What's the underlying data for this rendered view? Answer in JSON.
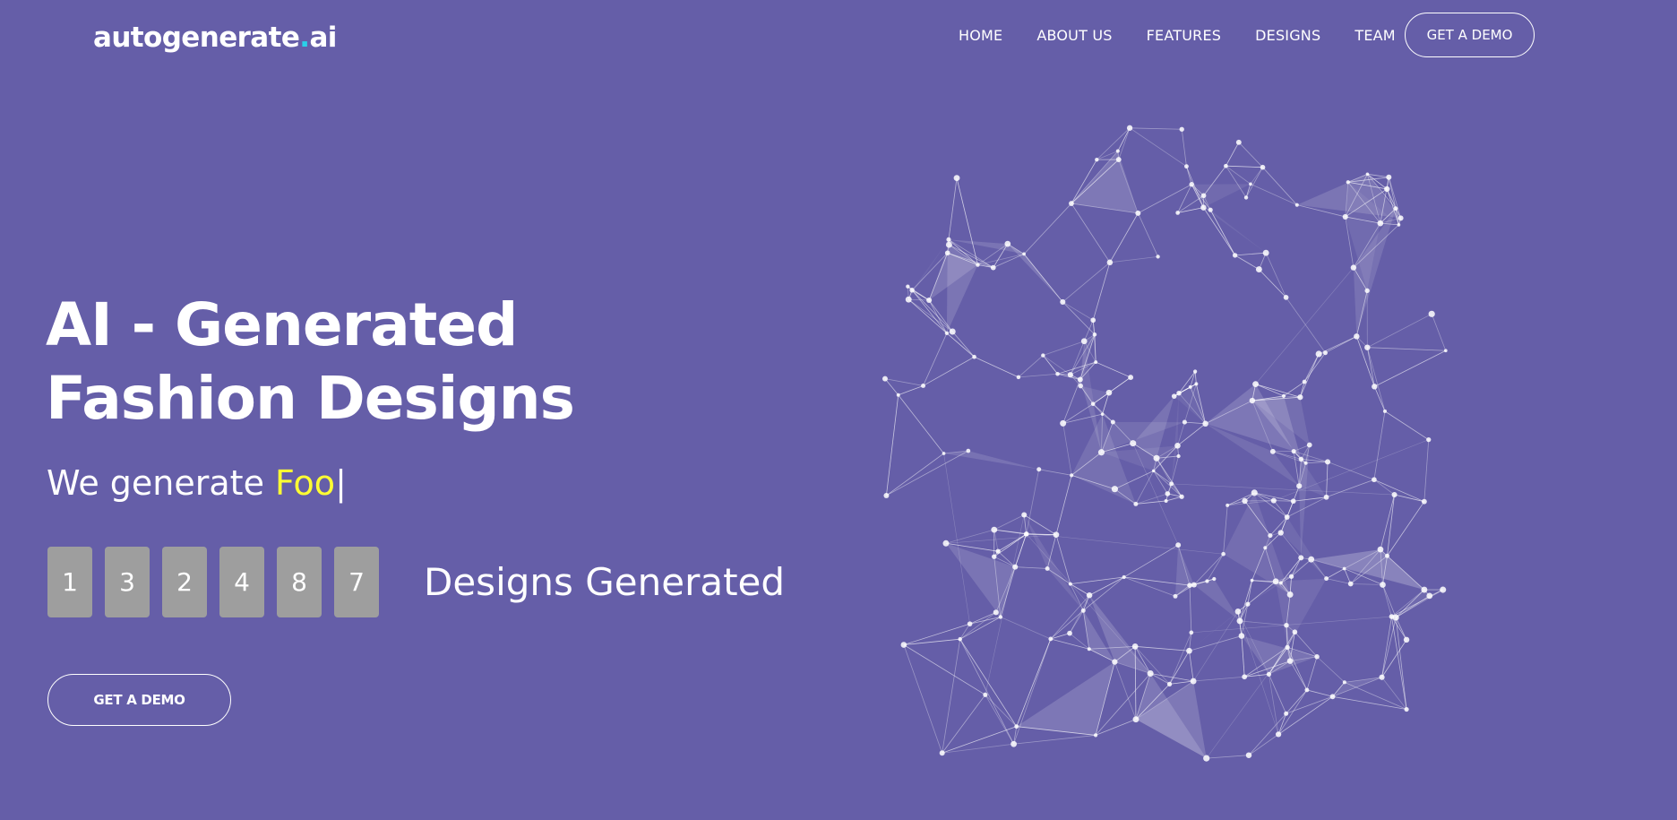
{
  "header": {
    "logo": {
      "before_accent": "autogenerate",
      "accent": ".",
      "after_accent": "ai"
    },
    "nav": [
      "HOME",
      "ABOUT US",
      "FEATURES",
      "DESIGNS",
      "TEAM"
    ],
    "cta_label": "GET A DEMO"
  },
  "hero": {
    "title_line1": "AI - Generated",
    "title_line2": "Fashion Designs",
    "tagline_prefix": "We generate ",
    "tagline_typed": "Foo",
    "tagline_cursor": "|",
    "counter_digits": [
      "1",
      "3",
      "2",
      "4",
      "8",
      "7"
    ],
    "counter_label": "Designs Generated",
    "cta_label": "GET A DEMO"
  },
  "colors": {
    "background": "#655ea8",
    "accent_text": "#ffff33",
    "logo_accent": "#2ad0e8",
    "digit_box": "#9e9e9e"
  }
}
